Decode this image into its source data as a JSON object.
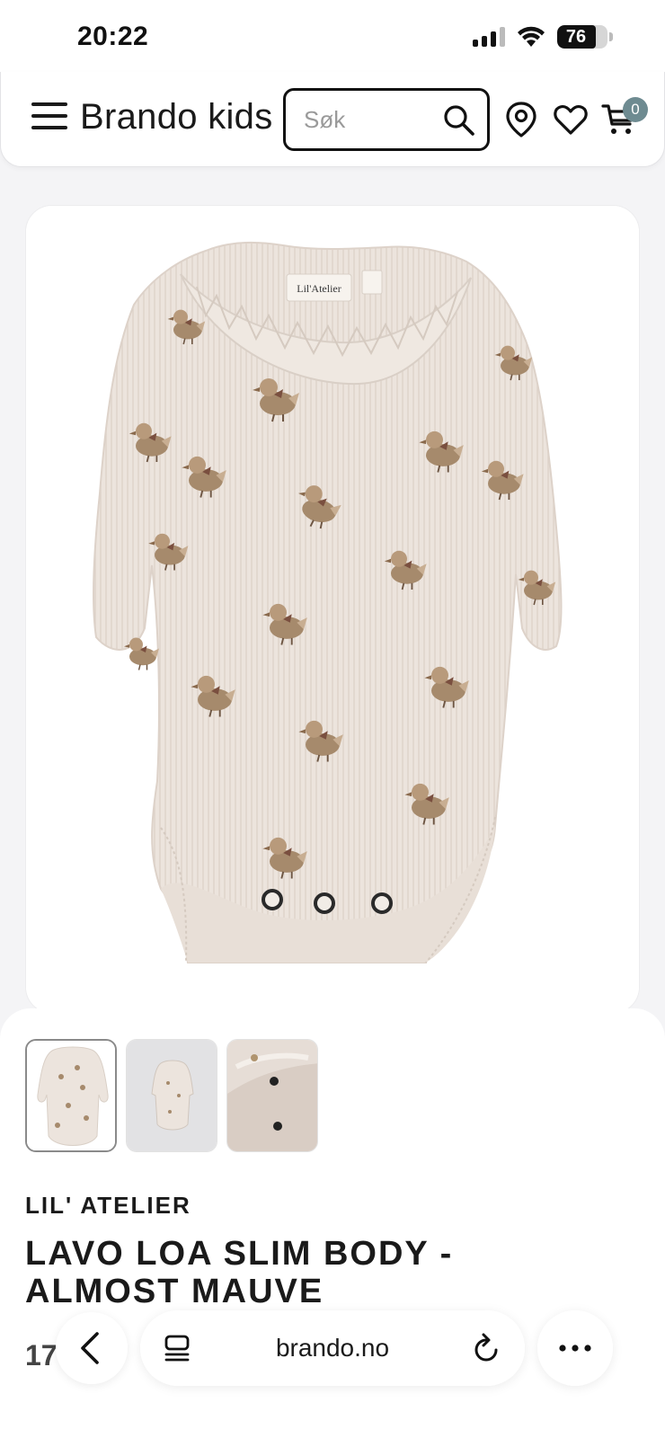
{
  "status_bar": {
    "time": "20:22",
    "battery_level": "76",
    "icons": [
      "signal-icon",
      "wifi-icon",
      "battery-icon"
    ]
  },
  "header": {
    "brand": "Brando kids",
    "search_placeholder": "Søk",
    "cart_count": "0",
    "icons": [
      "menu-icon",
      "search-icon",
      "location-pin-icon",
      "heart-icon",
      "cart-icon"
    ]
  },
  "product_image": {
    "label_tag_text": "Lil'Atelier"
  },
  "thumbnails": [
    {
      "name": "thumbnail-front",
      "active": true
    },
    {
      "name": "thumbnail-flat",
      "active": false
    },
    {
      "name": "thumbnail-detail",
      "active": false
    }
  ],
  "product": {
    "brand": "LIL' ATELIER",
    "title": "LAVO LOA SLIM BODY - ALMOST MAUVE",
    "price_partial": "17"
  },
  "browser": {
    "url": "brando.no",
    "icons": [
      "back-icon",
      "tabs-icon",
      "reload-icon",
      "more-icon"
    ]
  },
  "colors": {
    "background": "#f4f4f6",
    "garment": "#ece4dd",
    "badge": "#6e8b91",
    "text": "#1a1a1a"
  }
}
